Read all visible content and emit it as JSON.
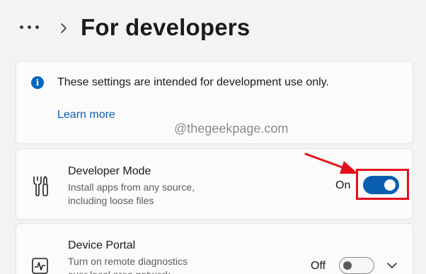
{
  "header": {
    "title": "For developers"
  },
  "info_card": {
    "message": "These settings are intended for development use only.",
    "link": "Learn more"
  },
  "watermark": "@thegeekpage.com",
  "developer_mode": {
    "title": "Developer Mode",
    "desc_line1": "Install apps from any source,",
    "desc_line2": "including loose files",
    "state_label": "On",
    "enabled": true,
    "icon": "tools-icon"
  },
  "device_portal": {
    "title": "Device Portal",
    "desc_line1": "Turn on remote diagnostics",
    "desc_line2": "over local area network",
    "state_label": "Off",
    "enabled": false,
    "icon": "activity-monitor-icon"
  },
  "colors": {
    "accent": "#0a5fb0",
    "annotation": "#e3101a"
  }
}
